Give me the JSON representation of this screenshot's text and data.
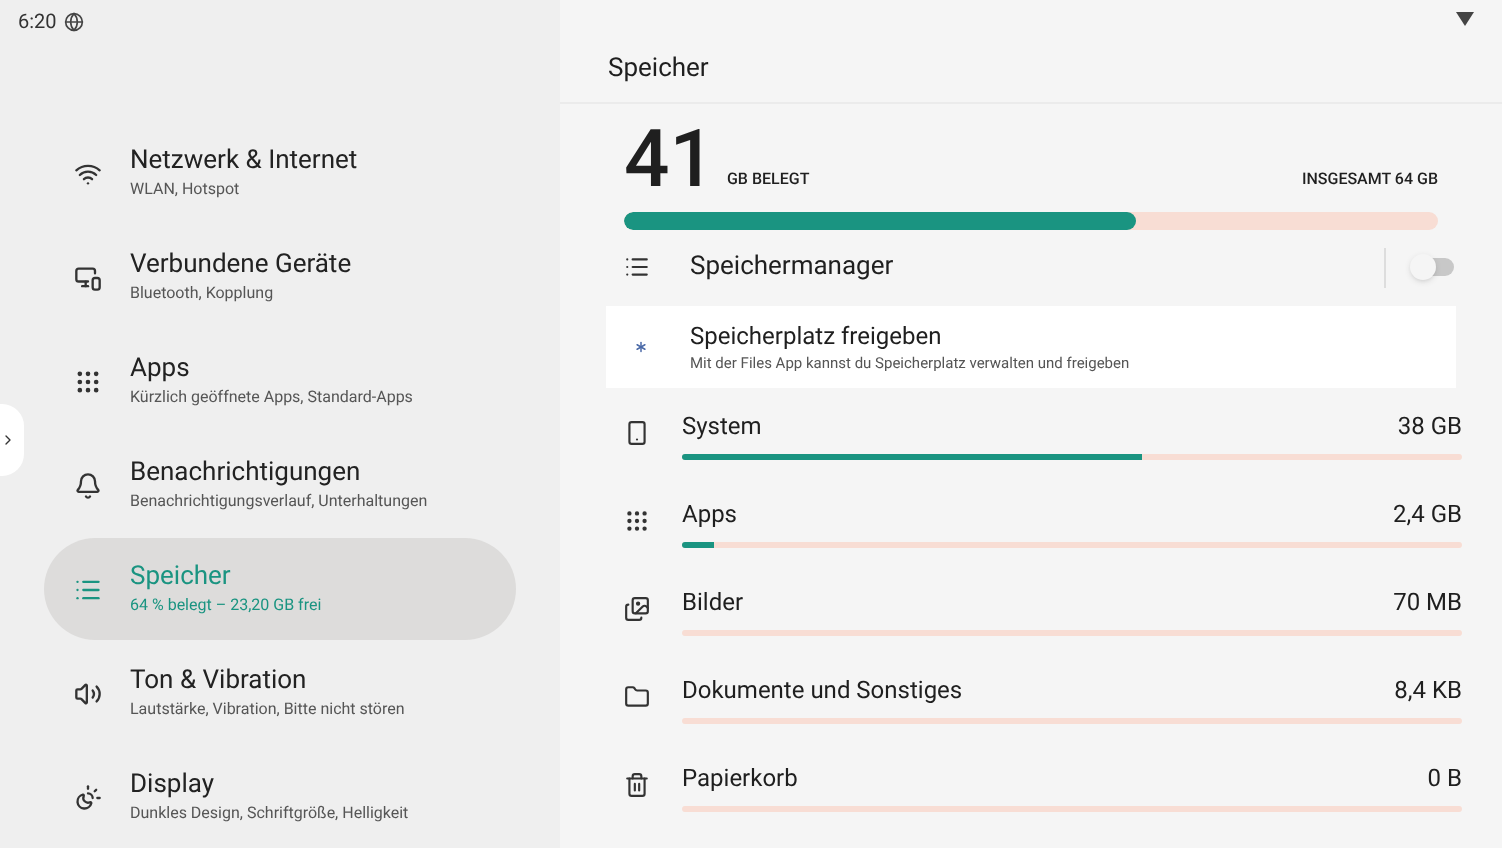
{
  "status_bar": {
    "time": "6:20"
  },
  "sidebar": {
    "items": [
      {
        "kind": "wifi",
        "title": "Netzwerk & Internet",
        "subtitle": "WLAN, Hotspot",
        "selected": false
      },
      {
        "kind": "devices",
        "title": "Verbundene Geräte",
        "subtitle": "Bluetooth, Kopplung",
        "selected": false
      },
      {
        "kind": "apps",
        "title": "Apps",
        "subtitle": "Kürzlich geöffnete Apps, Standard-Apps",
        "selected": false
      },
      {
        "kind": "bell",
        "title": "Benachrichtigungen",
        "subtitle": "Benachrichtigungsverlauf, Unterhaltungen",
        "selected": false
      },
      {
        "kind": "storage",
        "title": "Speicher",
        "subtitle": "64 % belegt – 23,20 GB frei",
        "selected": true
      },
      {
        "kind": "sound",
        "title": "Ton & Vibration",
        "subtitle": "Lautstärke, Vibration, Bitte nicht stören",
        "selected": false
      },
      {
        "kind": "display",
        "title": "Display",
        "subtitle": "Dunkles Design, Schriftgröße, Helligkeit",
        "selected": false
      }
    ]
  },
  "page": {
    "title": "Speicher",
    "usage": {
      "amount": "41",
      "unit": "GB BELEGT",
      "total": "INSGESAMT 64 GB",
      "level": 0.63
    },
    "manager": {
      "label": "Speichermanager",
      "on": false
    },
    "free_up": {
      "title": "Speicherplatz freigeben",
      "subtitle": "Mit der Files App kannst du Speicherplatz verwalten und freigeben"
    },
    "categories": [
      {
        "kind": "system",
        "label": "System",
        "size": "38 GB",
        "level": 0.59
      },
      {
        "kind": "apps",
        "label": "Apps",
        "size": "2,4 GB",
        "level": 0.04
      },
      {
        "kind": "images",
        "label": "Bilder",
        "size": "70 MB",
        "level": 0
      },
      {
        "kind": "folder",
        "label": "Dokumente und Sonstiges",
        "size": "8,4 KB",
        "level": 0
      },
      {
        "kind": "trash",
        "label": "Papierkorb",
        "size": "0 B",
        "level": 0
      }
    ]
  }
}
